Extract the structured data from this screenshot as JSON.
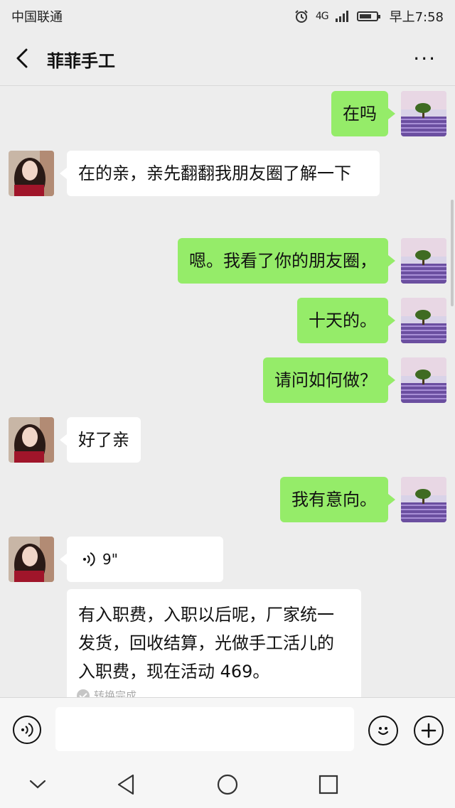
{
  "status_bar": {
    "carrier": "中国联通",
    "network": "4G",
    "time": "早上7:58"
  },
  "header": {
    "title": "菲菲手工",
    "more": "···"
  },
  "messages": [
    {
      "from": "me",
      "text": "在吗"
    },
    {
      "from": "her",
      "text": "在的亲，亲先翻翻我朋友圈了解一下"
    },
    {
      "from": "me",
      "text": "嗯。我看了你的朋友圈，"
    },
    {
      "from": "me",
      "text": "十天的。"
    },
    {
      "from": "me",
      "text": "请问如何做？"
    },
    {
      "from": "her",
      "text": "好了亲"
    },
    {
      "from": "me",
      "text": "我有意向。"
    },
    {
      "from": "her",
      "type": "voice",
      "duration": "9\""
    },
    {
      "from": "her",
      "type": "transcript",
      "text": "有入职费，入职以后呢，厂家统一发货，回收结算，光做手工活儿的入职费，现在活动 469。",
      "status": "转换完成"
    }
  ],
  "icons": {
    "voice_input": "voice-icon",
    "emoji": "emoji-icon",
    "plus": "plus-icon"
  },
  "colors": {
    "outgoing_bubble": "#95ec69",
    "incoming_bubble": "#ffffff",
    "background": "#ededed"
  }
}
